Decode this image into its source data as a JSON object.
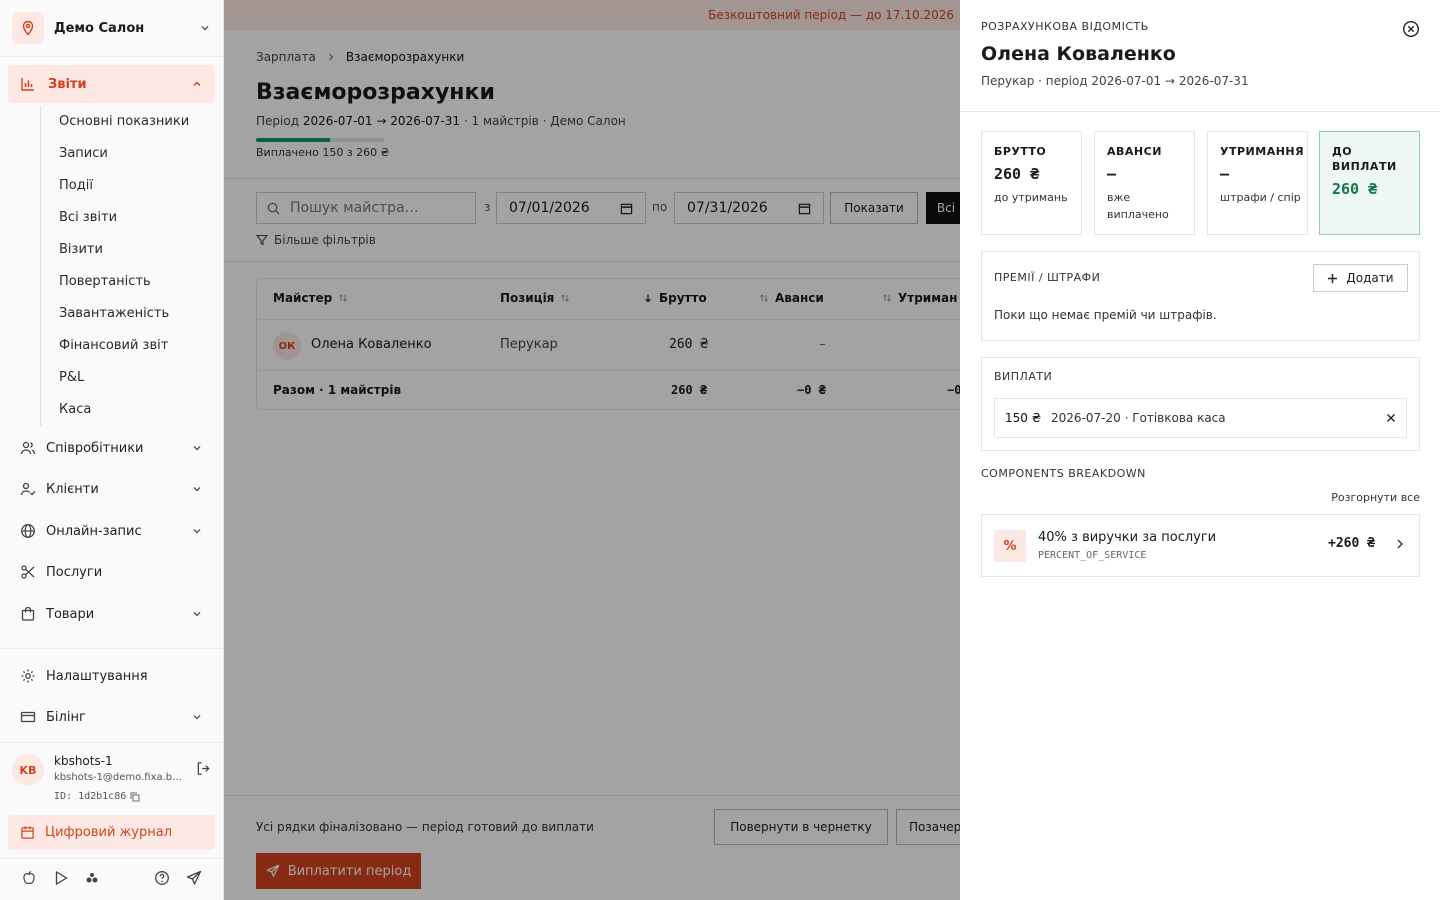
{
  "sidebar": {
    "salon_name": "Демо Салон",
    "reports_label": "Звіти",
    "report_items": [
      "Основні показники",
      "Записи",
      "Події",
      "Всі звіти",
      "Візити",
      "Повертаність",
      "Завантаженість",
      "Фінансовий звіт",
      "P&L",
      "Каса"
    ],
    "nav": {
      "employees": "Співробітники",
      "clients": "Клієнти",
      "online": "Онлайн-запис",
      "services": "Послуги",
      "goods": "Товари",
      "settings": "Налаштування",
      "billing": "Білінг"
    },
    "user": {
      "initials": "KB",
      "name": "kbshots-1",
      "email": "kbshots-1@demo.fixa.b…",
      "id": "ID: 1d2b1c86"
    },
    "journal_label": "Цифровий журнал"
  },
  "main": {
    "banner": "Безкоштовний період — до 17.10.2026",
    "breadcrumb": {
      "parent": "Зарплата",
      "current": "Взаєморозрахунки"
    },
    "title": "Взаєморозрахунки",
    "period": {
      "prefix": "Період",
      "start": "2026-07-01",
      "arrow": "→",
      "end": "2026-07-31",
      "rest": "· 1 майстрів · Демо Салон"
    },
    "paid_fraction": 0.577,
    "paid_text": "Виплачено 150 з 260 ₴",
    "search_placeholder": "Пошук майстра…",
    "from_label": "з",
    "to_label": "по",
    "date_from": "07/01/2026",
    "date_to": "07/31/2026",
    "show_button": "Показати",
    "all_button": "Всі",
    "more_filters": "Більше фільтрів",
    "table": {
      "headers": {
        "master": "Майстер",
        "position": "Позиція",
        "gross": "Брутто",
        "advances": "Аванси",
        "deductions": "Утриман"
      },
      "row": {
        "initials": "ОК",
        "name": "Олена Коваленко",
        "position": "Перукар",
        "gross": "260 ₴",
        "advances": "–"
      },
      "total": {
        "label": "Разом · 1 майстрів",
        "gross": "260 ₴",
        "advances": "−0 ₴",
        "deductions": "−0"
      }
    },
    "final_text": "Усі рядки фіналізовано — період готовий до виплати",
    "revert_button": "Повернути в чернетку",
    "lock_button": "Позачер",
    "pay_button": "Виплатити період"
  },
  "drawer": {
    "kicker": "РОЗРАХУНКОВА ВІДОМІСТЬ",
    "name": "Олена Коваленко",
    "subtitle": "Перукар · період 2026-07-01 → 2026-07-31",
    "stats": {
      "gross": {
        "label": "БРУТТО",
        "value": "260 ₴",
        "note": "до утримань"
      },
      "advances": {
        "label": "АВАНСИ",
        "value": "—",
        "note": "вже виплачено"
      },
      "deductions": {
        "label": "УТРИМАННЯ",
        "value": "—",
        "note": "штрафи / спір"
      },
      "payout": {
        "label": "ДО ВИПЛАТИ",
        "value": "260 ₴"
      }
    },
    "bonuses": {
      "title": "ПРЕМІЇ / ШТРАФИ",
      "add_button": "Додати",
      "empty": "Поки що немає премій чи штрафів."
    },
    "payments": {
      "title": "ВИПЛАТИ",
      "amount": "150 ₴",
      "detail": "2026-07-20 · Готівкова каса"
    },
    "components": {
      "title": "COMPONENTS BREAKDOWN",
      "expand_all": "Розгорнути все",
      "item": {
        "icon": "%",
        "title": "40% з виручки за послуги",
        "code": "PERCENT_OF_SERVICE",
        "amount": "+260 ₴"
      }
    }
  },
  "colors": {
    "accent": "#d4421e",
    "accent_bg": "#fde8e3",
    "success": "#0f7a48"
  }
}
